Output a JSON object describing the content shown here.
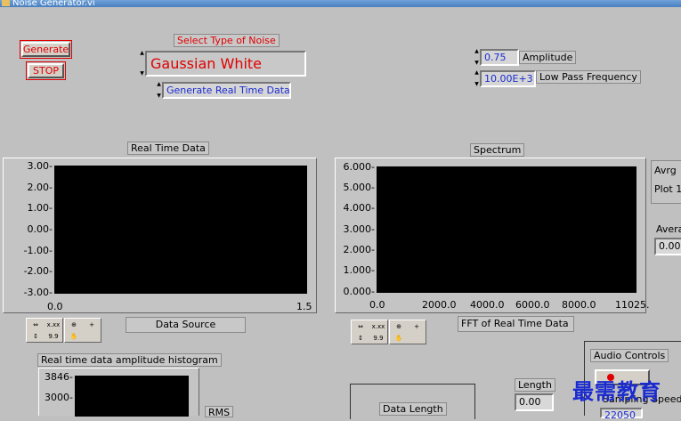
{
  "window": {
    "title": "Noise Generator.vi"
  },
  "controls": {
    "generate_label": "Generate",
    "stop_label": "STOP",
    "noise_type_label": "Select Type of Noise",
    "noise_type_value": "Gaussian White",
    "mode_value": "Generate Real Time Data",
    "amplitude_value": "0.75",
    "amplitude_label": "Amplitude",
    "lpf_value": "10.00E+3",
    "lpf_label": "Low Pass Frequency"
  },
  "realtime_graph": {
    "title": "Real Time Data",
    "y_ticks": [
      "3.00-",
      "2.00-",
      "1.00-",
      "0.00-",
      "-1.00-",
      "-2.00-",
      "-3.00-"
    ],
    "x_ticks": [
      "0.0",
      "1.5"
    ],
    "source_label": "Data Source"
  },
  "spectrum_graph": {
    "title": "Spectrum",
    "y_ticks": [
      "6.000-",
      "5.000-",
      "4.000-",
      "3.000-",
      "2.000-",
      "1.000-",
      "0.000-"
    ],
    "x_ticks": [
      "0.0",
      "2000.0",
      "4000.0",
      "6000.0",
      "8000.0",
      "11025."
    ],
    "source_label": "FFT of Real Time Data"
  },
  "side_panel": {
    "avrg_label": "Avrg",
    "plot_label": "Plot 1",
    "avera_label": "Avera",
    "avera_value": "0.00"
  },
  "histogram": {
    "title": "Real time data amplitude histogram",
    "y_ticks": [
      "3846-",
      "3000-"
    ],
    "rms_label": "RMS"
  },
  "bottom": {
    "data_length_label": "Data Length",
    "length_label": "Length",
    "length_value": "0.00",
    "audio_controls_label": "Audio Controls",
    "sampling_speed_label": "Sampling Speed",
    "sampling_value": "22050"
  },
  "palette": {
    "cells": [
      "⇔",
      "x.xx",
      "⊕",
      "+",
      "↕",
      "9.9",
      "✋"
    ]
  },
  "watermark": {
    "text": "最需教育"
  }
}
